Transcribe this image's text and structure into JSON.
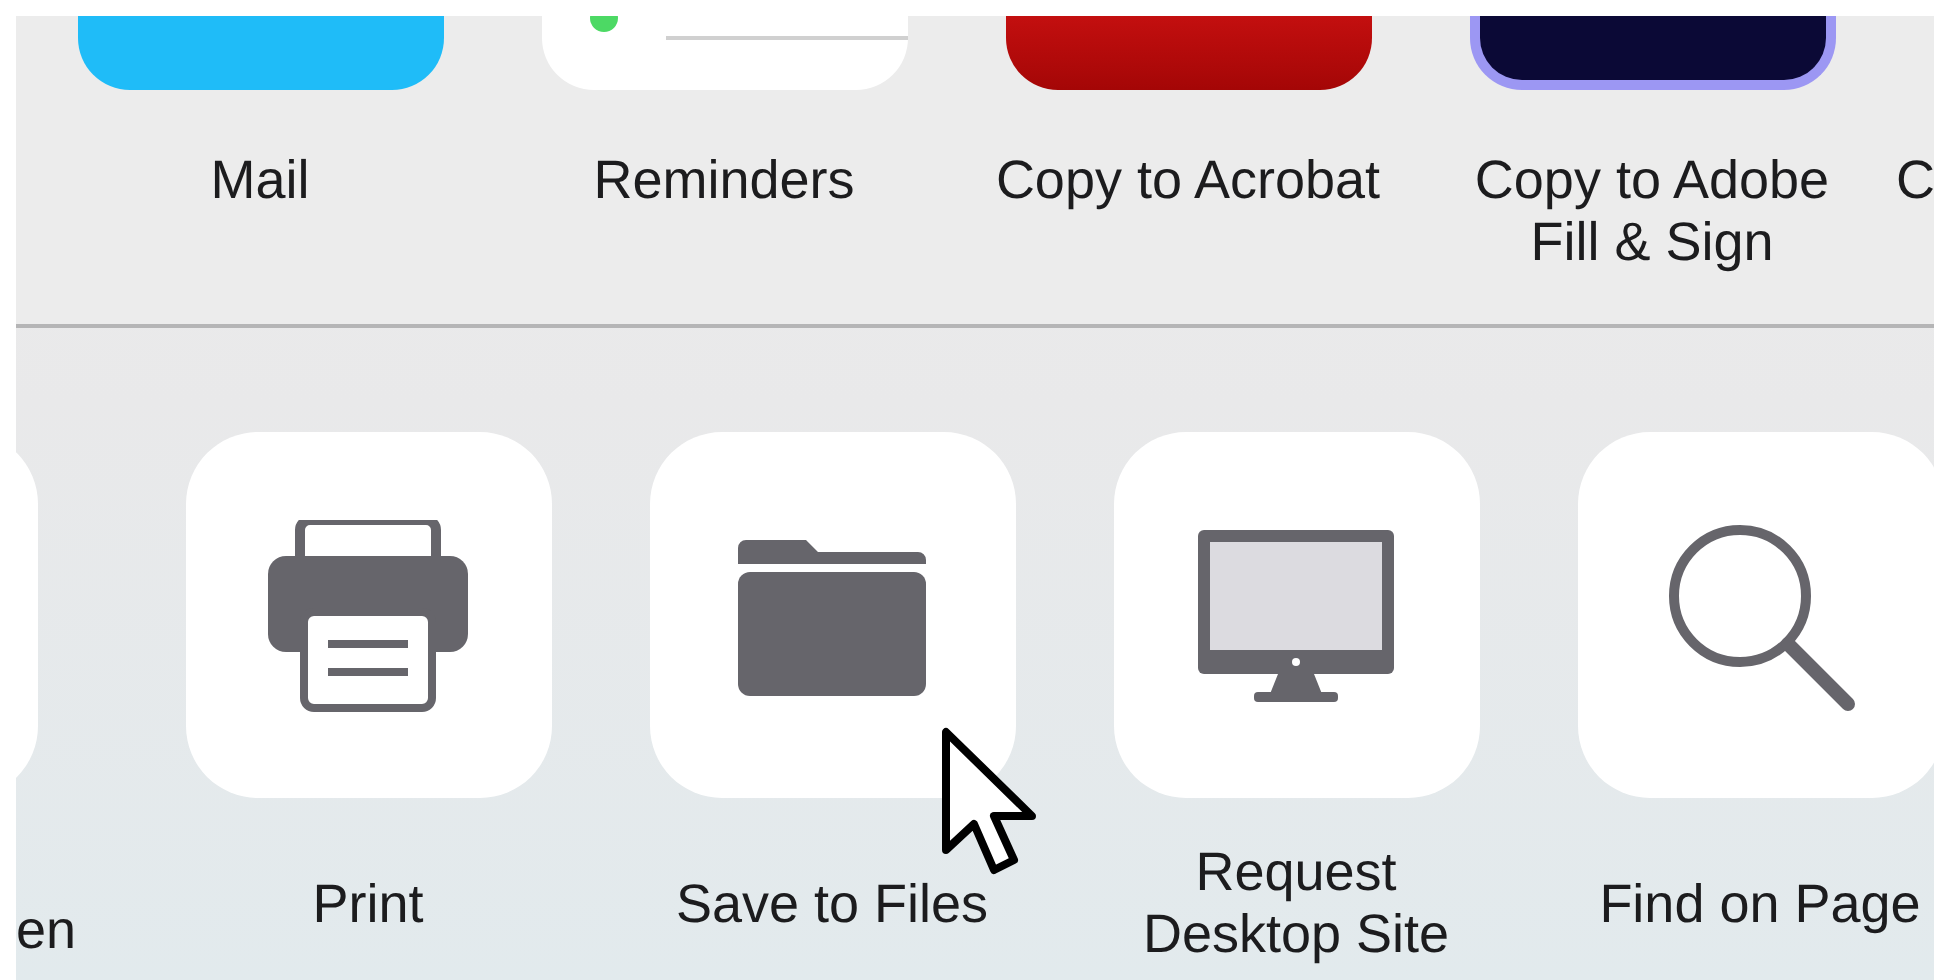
{
  "apps": [
    {
      "label": "Mail",
      "kind": "mail"
    },
    {
      "label": "Reminders",
      "kind": "reminders"
    },
    {
      "label": "Copy to Acrobat",
      "kind": "acrobat"
    },
    {
      "label": "Copy to Adobe Fill & Sign",
      "kind": "fillsign"
    },
    {
      "label": "C",
      "kind": "hidden"
    }
  ],
  "actions": [
    {
      "label": "en",
      "kind": "blank"
    },
    {
      "label": "Print",
      "kind": "print"
    },
    {
      "label": "Save to Files",
      "kind": "folder"
    },
    {
      "label": "Request Desktop Site",
      "kind": "desktop"
    },
    {
      "label": "Find on Page",
      "kind": "search"
    }
  ]
}
